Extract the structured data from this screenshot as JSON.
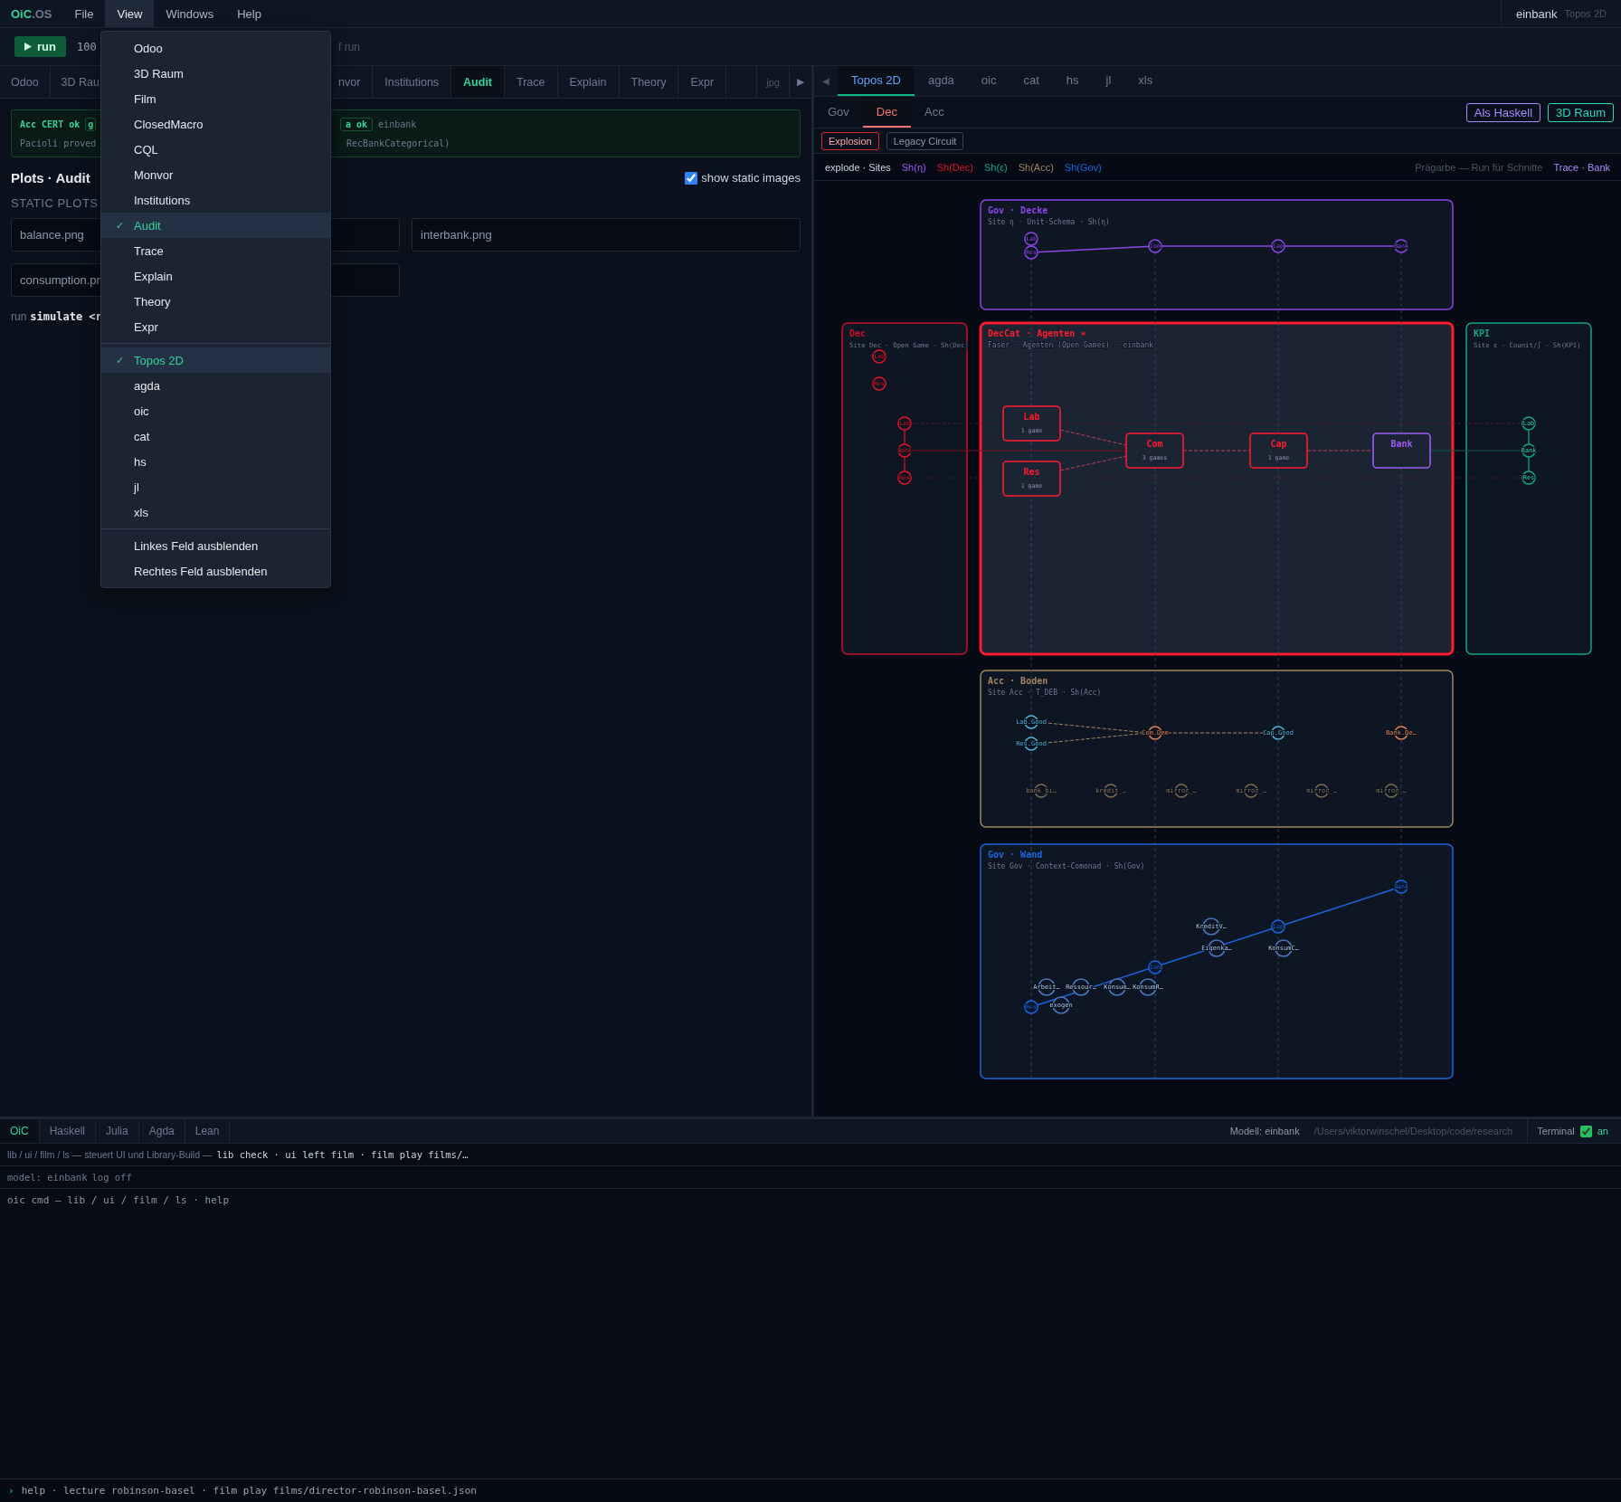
{
  "menubar": {
    "logo_main": "OiC",
    "logo_suffix": ".OS",
    "menus": [
      {
        "label": "File",
        "selected": false
      },
      {
        "label": "View",
        "selected": true
      },
      {
        "label": "Windows",
        "selected": false
      },
      {
        "label": "Help",
        "selected": false
      }
    ],
    "model": "einbank",
    "view": "Topos 2D"
  },
  "toolbar": {
    "run_label": "run",
    "count": "100",
    "hint": "f run"
  },
  "left": {
    "tabs_hidden_part": [
      {
        "label": "Odoo",
        "selected": false
      },
      {
        "label": "3D Rau",
        "selected": false
      }
    ],
    "tabs": [
      {
        "label": "nvor",
        "selected": false
      },
      {
        "label": "Institutions",
        "selected": false
      },
      {
        "label": "Audit",
        "selected": true
      },
      {
        "label": "Trace",
        "selected": false
      },
      {
        "label": "Explain",
        "selected": false
      },
      {
        "label": "Theory",
        "selected": false
      },
      {
        "label": "Expr",
        "selected": false
      }
    ],
    "tab_extra": "jpg",
    "tab_next": "▶",
    "cert": {
      "title": "Acc CERT ok",
      "badge_start": "g",
      "badge_end": "a ok",
      "model": "einbank",
      "proof": "Pacioli proved",
      "proof_tail": "RecBankCategorical)"
    },
    "heading": "Plots · Audit",
    "show_static": {
      "label": "show static images",
      "checked": true
    },
    "section": "STATIC PLOTS",
    "plots": [
      "balance.png",
      "interbank.png",
      "consumption.pn"
    ],
    "run_line": {
      "prefix": "run",
      "command": "simulate <r"
    }
  },
  "view_menu": {
    "check_mark": "✓",
    "groups": [
      [
        {
          "label": "Odoo",
          "checked": false
        },
        {
          "label": "3D Raum",
          "checked": false
        },
        {
          "label": "Film",
          "checked": false
        },
        {
          "label": "ClosedMacro",
          "checked": false
        },
        {
          "label": "CQL",
          "checked": false
        },
        {
          "label": "Monvor",
          "checked": false
        },
        {
          "label": "Institutions",
          "checked": false
        },
        {
          "label": "Audit",
          "checked": true
        },
        {
          "label": "Trace",
          "checked": false
        },
        {
          "label": "Explain",
          "checked": false
        },
        {
          "label": "Theory",
          "checked": false
        },
        {
          "label": "Expr",
          "checked": false
        }
      ],
      [
        {
          "label": "Topos 2D",
          "checked": true
        },
        {
          "label": "agda",
          "checked": false
        },
        {
          "label": "oic",
          "checked": false
        },
        {
          "label": "cat",
          "checked": false
        },
        {
          "label": "hs",
          "checked": false
        },
        {
          "label": "jl",
          "checked": false
        },
        {
          "label": "xls",
          "checked": false
        }
      ],
      [
        {
          "label": "Linkes Feld ausblenden",
          "checked": false
        },
        {
          "label": "Rechtes Feld ausblenden",
          "checked": false
        }
      ]
    ]
  },
  "right": {
    "prev": "◀",
    "tabs": [
      {
        "label": "Topos 2D",
        "selected": true
      },
      {
        "label": "agda",
        "selected": false
      },
      {
        "label": "oic",
        "selected": false
      },
      {
        "label": "cat",
        "selected": false
      },
      {
        "label": "hs",
        "selected": false
      },
      {
        "label": "jl",
        "selected": false
      },
      {
        "label": "xls",
        "selected": false
      }
    ],
    "subtabs": [
      {
        "label": "Gov",
        "selected": false
      },
      {
        "label": "Dec",
        "selected": true
      },
      {
        "label": "Acc",
        "selected": false
      }
    ],
    "actions": [
      {
        "label": "Als Haskell",
        "color": "#a78bfa"
      },
      {
        "label": "3D Raum",
        "color": "#2dd4bf"
      }
    ],
    "modes": [
      {
        "label": "Explosion",
        "selected": true
      },
      {
        "label": "Legacy Circuit",
        "selected": false
      }
    ],
    "legend": {
      "title": "explode · Sites",
      "items": [
        {
          "label": "Sh(η)",
          "color": "#9b5cf0"
        },
        {
          "label": "Sh(Dec)",
          "color": "#e01425"
        },
        {
          "label": "Sh(ε)",
          "color": "#14a383"
        },
        {
          "label": "Sh(Acc)",
          "color": "#a08660"
        },
        {
          "label": "Sh(Gov)",
          "color": "#1a66e0"
        }
      ],
      "note": "Prägarbe — Run für Schnitte",
      "trace": "Trace · Bank"
    }
  },
  "diagram": {
    "panels": [
      {
        "title": "Gov · Decke",
        "subtitle": "Site η · Unit-Schema · Sh(η)",
        "color": "#8b45e8",
        "selected": false
      },
      {
        "title": "Dec",
        "subtitle": "Site Dec · Open Game · Sh(Dec)",
        "color": "#c8102e",
        "selected": false
      },
      {
        "title": "DecCat · Agenten ∗",
        "subtitle": "Faser · Agenten (Open Games) · einbank",
        "color": "#ff1a2e",
        "selected": true
      },
      {
        "title": "KPI",
        "subtitle": "Site ε · Counit/∫ · Sh(KPI)",
        "color": "#14a383",
        "selected": false
      },
      {
        "title": "Acc · Boden",
        "subtitle": "Site Acc · T_DEB · Sh(Acc)",
        "color": "#a08660",
        "selected": false
      },
      {
        "title": "Gov · Wand",
        "subtitle": "Site Gov · Context-Comonad · Sh(Gov)",
        "color": "#1a66e0",
        "selected": false
      }
    ],
    "decke_nodes": [
      "Lab",
      "Res",
      "Com",
      "Cap",
      "Bank"
    ],
    "dec_nodes": [
      "Lab",
      "Res",
      "Lab",
      "Bank",
      "Res"
    ],
    "agents": [
      {
        "name": "Lab",
        "note": "1 game",
        "color": "#ff1a2e"
      },
      {
        "name": "Res",
        "note": "1 game",
        "color": "#ff1a2e"
      },
      {
        "name": "Com",
        "note": "3 games",
        "color": "#ff1a2e"
      },
      {
        "name": "Cap",
        "note": "1 game",
        "color": "#ff1a2e"
      },
      {
        "name": "Bank",
        "color": "#9b5cf0"
      }
    ],
    "kpi_nodes": [
      "Lab",
      "Bank",
      "Res"
    ],
    "acc_nodes": [
      {
        "label": "Lab.Good",
        "color": "#4fb3d9"
      },
      {
        "label": "Res.Good",
        "color": "#4fb3d9"
      },
      {
        "label": "Com.Dem",
        "color": "#e0834f"
      },
      {
        "label": "Cap.Good",
        "color": "#4fb3d9"
      },
      {
        "label": "Bank.De…",
        "color": "#e0834f"
      }
    ],
    "acc_mirrors": [
      "bank_bi…",
      "kredit_…",
      "mirror_…",
      "mirror_…",
      "mirror_…",
      "mirror_…"
    ],
    "wand_nodes": [
      "Res",
      "Com",
      "Cap",
      "Bank"
    ],
    "wand_extras": [
      "KreditV…",
      "Eigenka…",
      "KonsumC…",
      "Arbeit…",
      "exogen",
      "Ressour…",
      "Konsum…",
      "KonsumR…"
    ]
  },
  "console": {
    "tabs": [
      {
        "label": "OiC",
        "selected": true
      },
      {
        "label": "Haskell",
        "selected": false
      },
      {
        "label": "Julia",
        "selected": false
      },
      {
        "label": "Agda",
        "selected": false
      },
      {
        "label": "Lean",
        "selected": false
      }
    ],
    "model": "Modell: einbank",
    "path": "/Users/viktorwinschel/Desktop/code/research",
    "terminal": {
      "label": "Terminal",
      "checked": true,
      "state": "an"
    },
    "help_line": {
      "text": "lib / ui / film / ls — steuert UI und Library-Build —",
      "commands": "lib check · ui left film · film play films/…"
    },
    "status": [
      "model: einbank",
      "log off"
    ],
    "output": "oic cmd — lib / ui / film / ls · help",
    "prompt": "›",
    "prompt_hint": "help · lecture robinson-basel · film play films/director-robinson-basel.json"
  }
}
